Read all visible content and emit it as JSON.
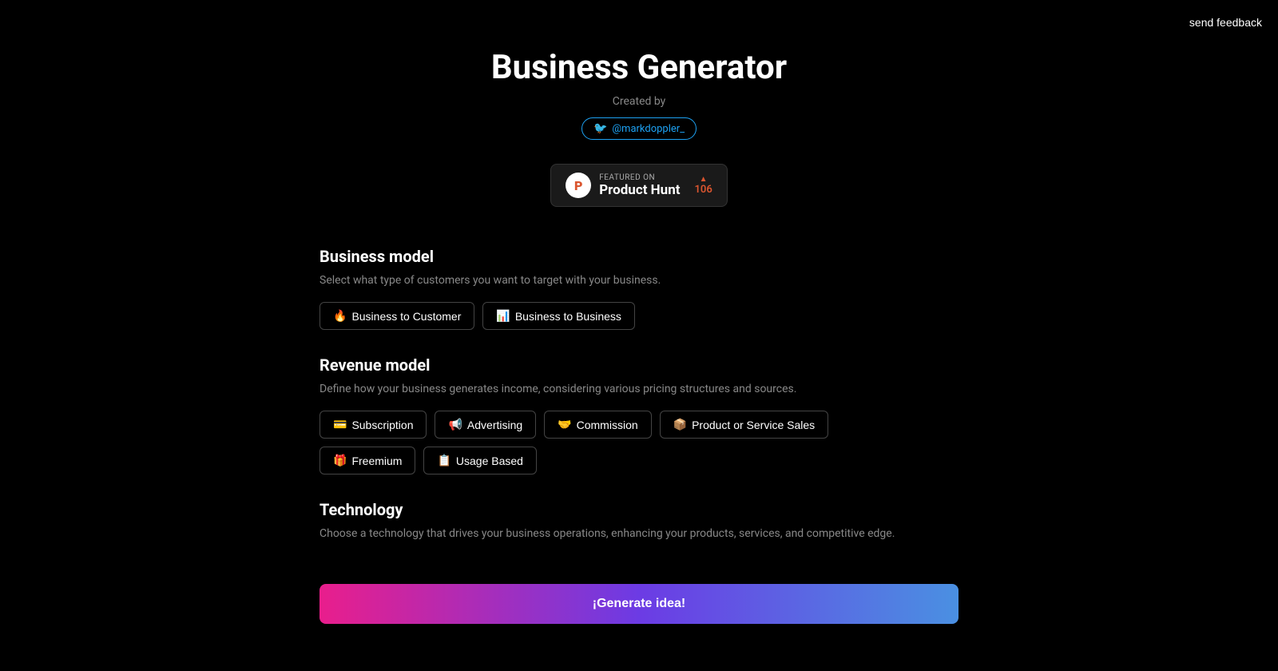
{
  "feedback": {
    "label": "send feedback"
  },
  "header": {
    "title": "Business Generator",
    "created_by": "Created by",
    "twitter": {
      "handle": "@markdoppler_",
      "prefix": "🐦"
    }
  },
  "product_hunt": {
    "featured_on": "FEATURED ON",
    "name": "Product Hunt",
    "count": "106",
    "logo_letter": "P"
  },
  "sections": {
    "business_model": {
      "title": "Business model",
      "description": "Select what type of customers you want to target with your business.",
      "options": [
        {
          "emoji": "🔥",
          "label": "Business to Customer"
        },
        {
          "emoji": "📊",
          "label": "Business to Business"
        }
      ]
    },
    "revenue_model": {
      "title": "Revenue model",
      "description": "Define how your business generates income, considering various pricing structures and sources.",
      "options_row1": [
        {
          "emoji": "💳",
          "label": "Subscription"
        },
        {
          "emoji": "📢",
          "label": "Advertising"
        },
        {
          "emoji": "🤝",
          "label": "Commission"
        },
        {
          "emoji": "📦",
          "label": "Product or Service Sales"
        }
      ],
      "options_row2": [
        {
          "emoji": "🎁",
          "label": "Freemium"
        },
        {
          "emoji": "📋",
          "label": "Usage Based"
        }
      ]
    },
    "technology": {
      "title": "Technology",
      "description": "Choose a technology that drives your business operations, enhancing your products, services, and competitive edge."
    }
  },
  "generate_button": {
    "label": "¡Generate idea!"
  }
}
